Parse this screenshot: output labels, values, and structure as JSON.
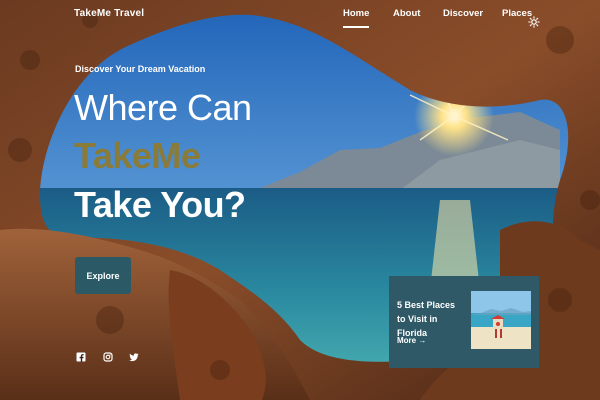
{
  "brand": "TakeMe Travel",
  "nav": {
    "items": [
      {
        "label": "Home",
        "active": true
      },
      {
        "label": "About",
        "active": false
      },
      {
        "label": "Discover",
        "active": false
      },
      {
        "label": "Places",
        "active": false
      }
    ],
    "theme_icon": "sun-icon"
  },
  "hero": {
    "tagline": "Discover Your Dream Vacation",
    "line1": "Where Can",
    "line2": "TakeMe",
    "line3": "Take You?",
    "button": "Explore"
  },
  "social": [
    "facebook-icon",
    "instagram-icon",
    "twitter-icon"
  ],
  "card": {
    "title": "5 Best Places to Visit in Florida",
    "more": "More",
    "thumb_icon": "beach-photo"
  },
  "colors": {
    "accent_gold": "#8a7b38",
    "button_teal": "#2b5a66",
    "card_teal": "#2f5966"
  }
}
